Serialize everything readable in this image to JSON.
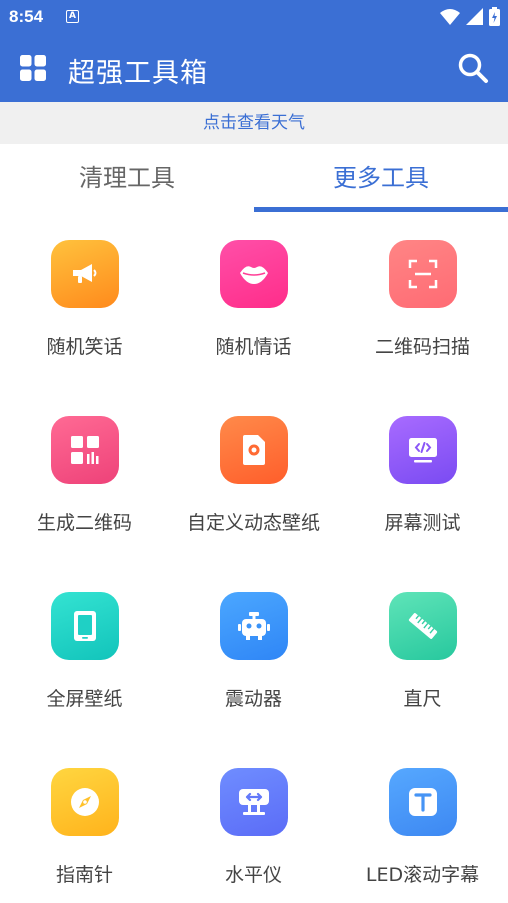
{
  "status_bar": {
    "time": "8:54",
    "notification": "A"
  },
  "app_bar": {
    "title": "超强工具箱"
  },
  "weather": {
    "label": "点击查看天气"
  },
  "tabs": [
    {
      "label": "清理工具",
      "selected": false
    },
    {
      "label": "更多工具",
      "selected": true
    }
  ],
  "colors": {
    "primary": "#3b6fd4",
    "weather_bg": "#f0f0f0"
  },
  "tools": [
    {
      "label": "随机笑话",
      "icon": "megaphone-icon",
      "gradient": [
        "#ffc23d",
        "#ff8a1c"
      ]
    },
    {
      "label": "随机情话",
      "icon": "lips-icon",
      "gradient": [
        "#ff4fa8",
        "#ff2d8a"
      ]
    },
    {
      "label": "二维码扫描",
      "icon": "scan-icon",
      "gradient": [
        "#ff8585",
        "#ff6b74"
      ]
    },
    {
      "label": "生成二维码",
      "icon": "qrcode-icon",
      "gradient": [
        "#ff6a94",
        "#ee4279"
      ]
    },
    {
      "label": "自定义动态壁纸",
      "icon": "phone-dot-icon",
      "gradient": [
        "#ff8a4a",
        "#ff5e2b"
      ]
    },
    {
      "label": "屏幕测试",
      "icon": "code-screen-icon",
      "gradient": [
        "#a86bff",
        "#7a4bf2"
      ]
    },
    {
      "label": "全屏壁纸",
      "icon": "phone-icon",
      "gradient": [
        "#34e3d2",
        "#12c4bb"
      ]
    },
    {
      "label": "震动器",
      "icon": "robot-icon",
      "gradient": [
        "#4ba7ff",
        "#2f86f6"
      ]
    },
    {
      "label": "直尺",
      "icon": "ruler-icon",
      "gradient": [
        "#5fe4b8",
        "#27c89e"
      ]
    },
    {
      "label": "指南针",
      "icon": "compass-icon",
      "gradient": [
        "#ffd640",
        "#ffb31c"
      ]
    },
    {
      "label": "水平仪",
      "icon": "level-icon",
      "gradient": [
        "#6f8dff",
        "#5b6cf7"
      ]
    },
    {
      "label": "LED滚动字幕",
      "icon": "text-t-icon",
      "gradient": [
        "#56a8ff",
        "#3d88f2"
      ]
    }
  ]
}
